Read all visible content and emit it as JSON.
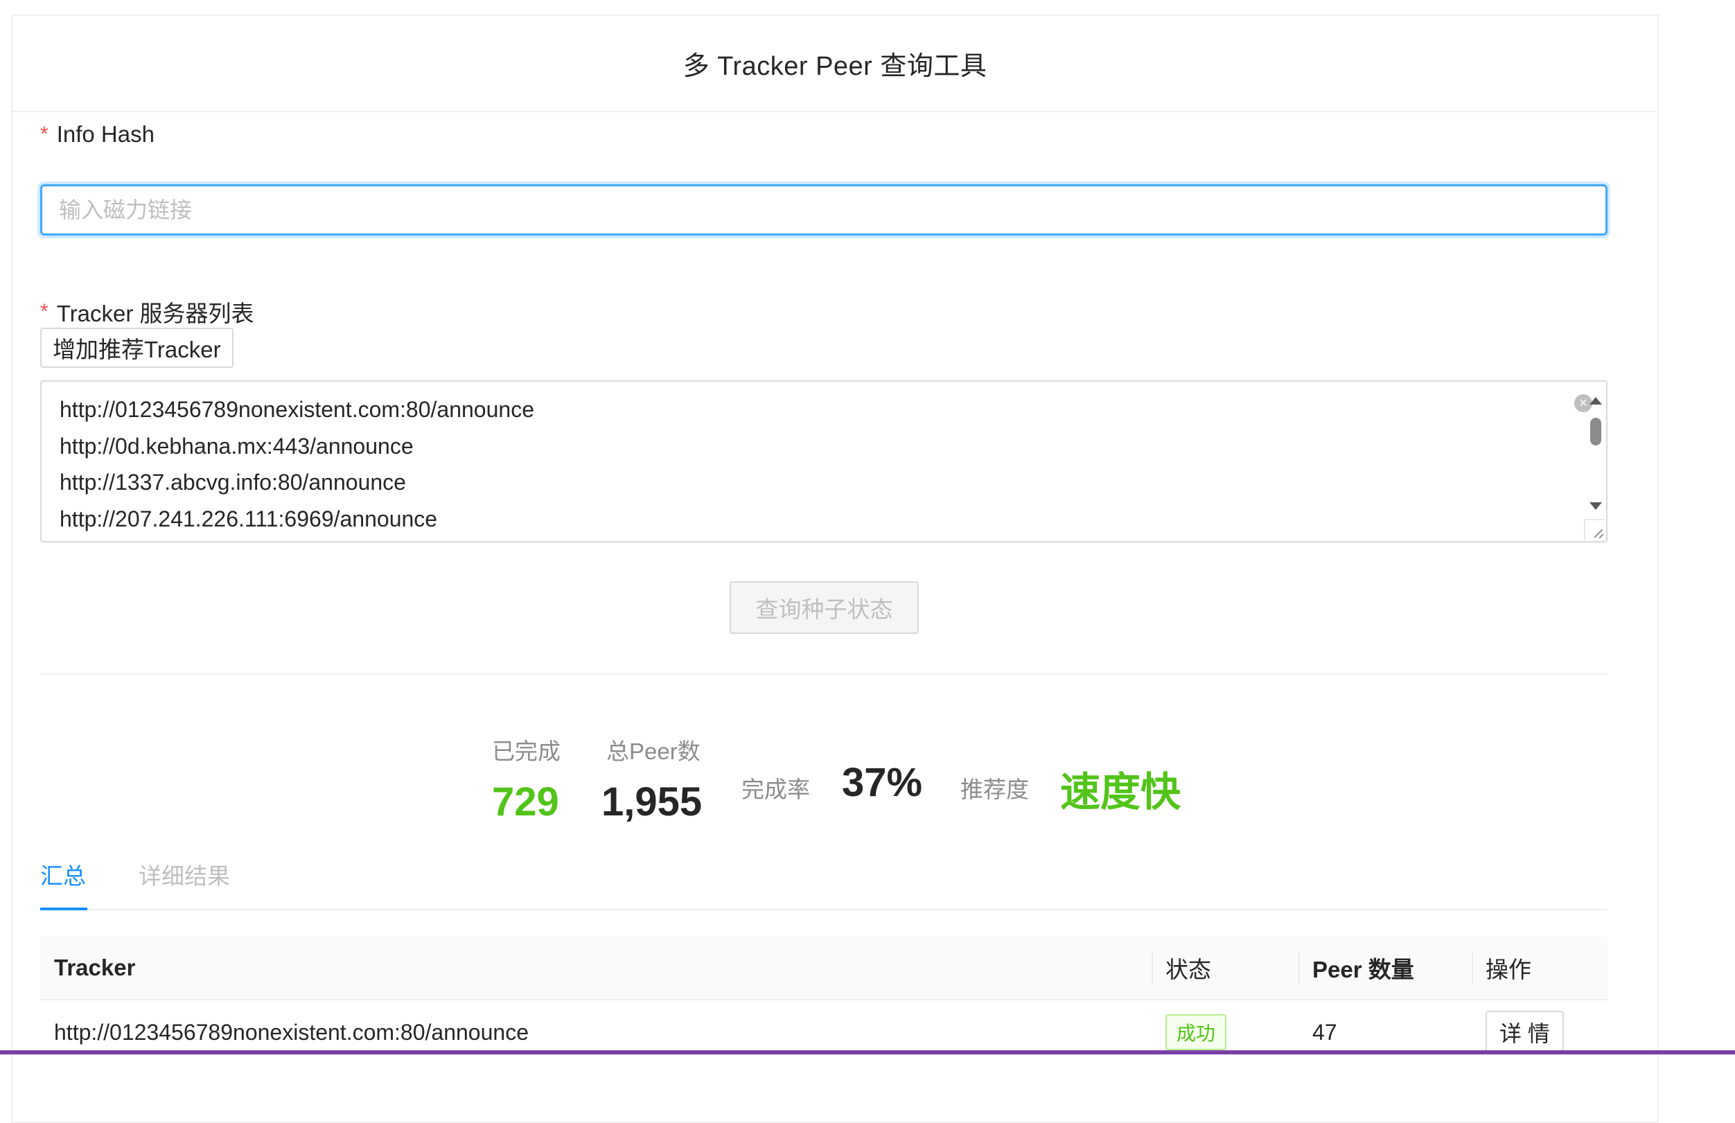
{
  "header": {
    "title": "多 Tracker Peer 查询工具"
  },
  "form": {
    "info_hash": {
      "required_mark": "*",
      "label": "Info Hash",
      "placeholder": "输入磁力链接",
      "value": ""
    },
    "trackers": {
      "required_mark": "*",
      "label": "Tracker 服务器列表",
      "add_button": "增加推荐Tracker",
      "lines": [
        "http://0123456789nonexistent.com:80/announce",
        "http://0d.kebhana.mx:443/announce",
        "http://1337.abcvg.info:80/announce",
        "http://207.241.226.111:6969/announce"
      ]
    },
    "query_button": "查询种子状态"
  },
  "stats": {
    "completed_label": "已完成",
    "completed_value": "729",
    "total_label": "总Peer数",
    "total_value": "1,955",
    "rate_label": "完成率",
    "rate_value": "37%",
    "recommend_label": "推荐度",
    "recommend_value": "速度快"
  },
  "tabs": [
    {
      "label": "汇总",
      "active": true
    },
    {
      "label": "详细结果",
      "active": false
    }
  ],
  "table": {
    "columns": [
      "Tracker",
      "状态",
      "Peer 数量",
      "操作"
    ],
    "rows": [
      {
        "tracker": "http://0123456789nonexistent.com:80/announce",
        "status": "成功",
        "peers": "47",
        "action": "详 情"
      }
    ]
  },
  "colors": {
    "primary": "#1890ff",
    "success": "#52c41a",
    "required": "#ff4d4f",
    "border": "#d9d9d9"
  },
  "icons": [
    "clear-icon",
    "scroll-up-icon",
    "scroll-down-icon",
    "resize-handle-icon"
  ]
}
